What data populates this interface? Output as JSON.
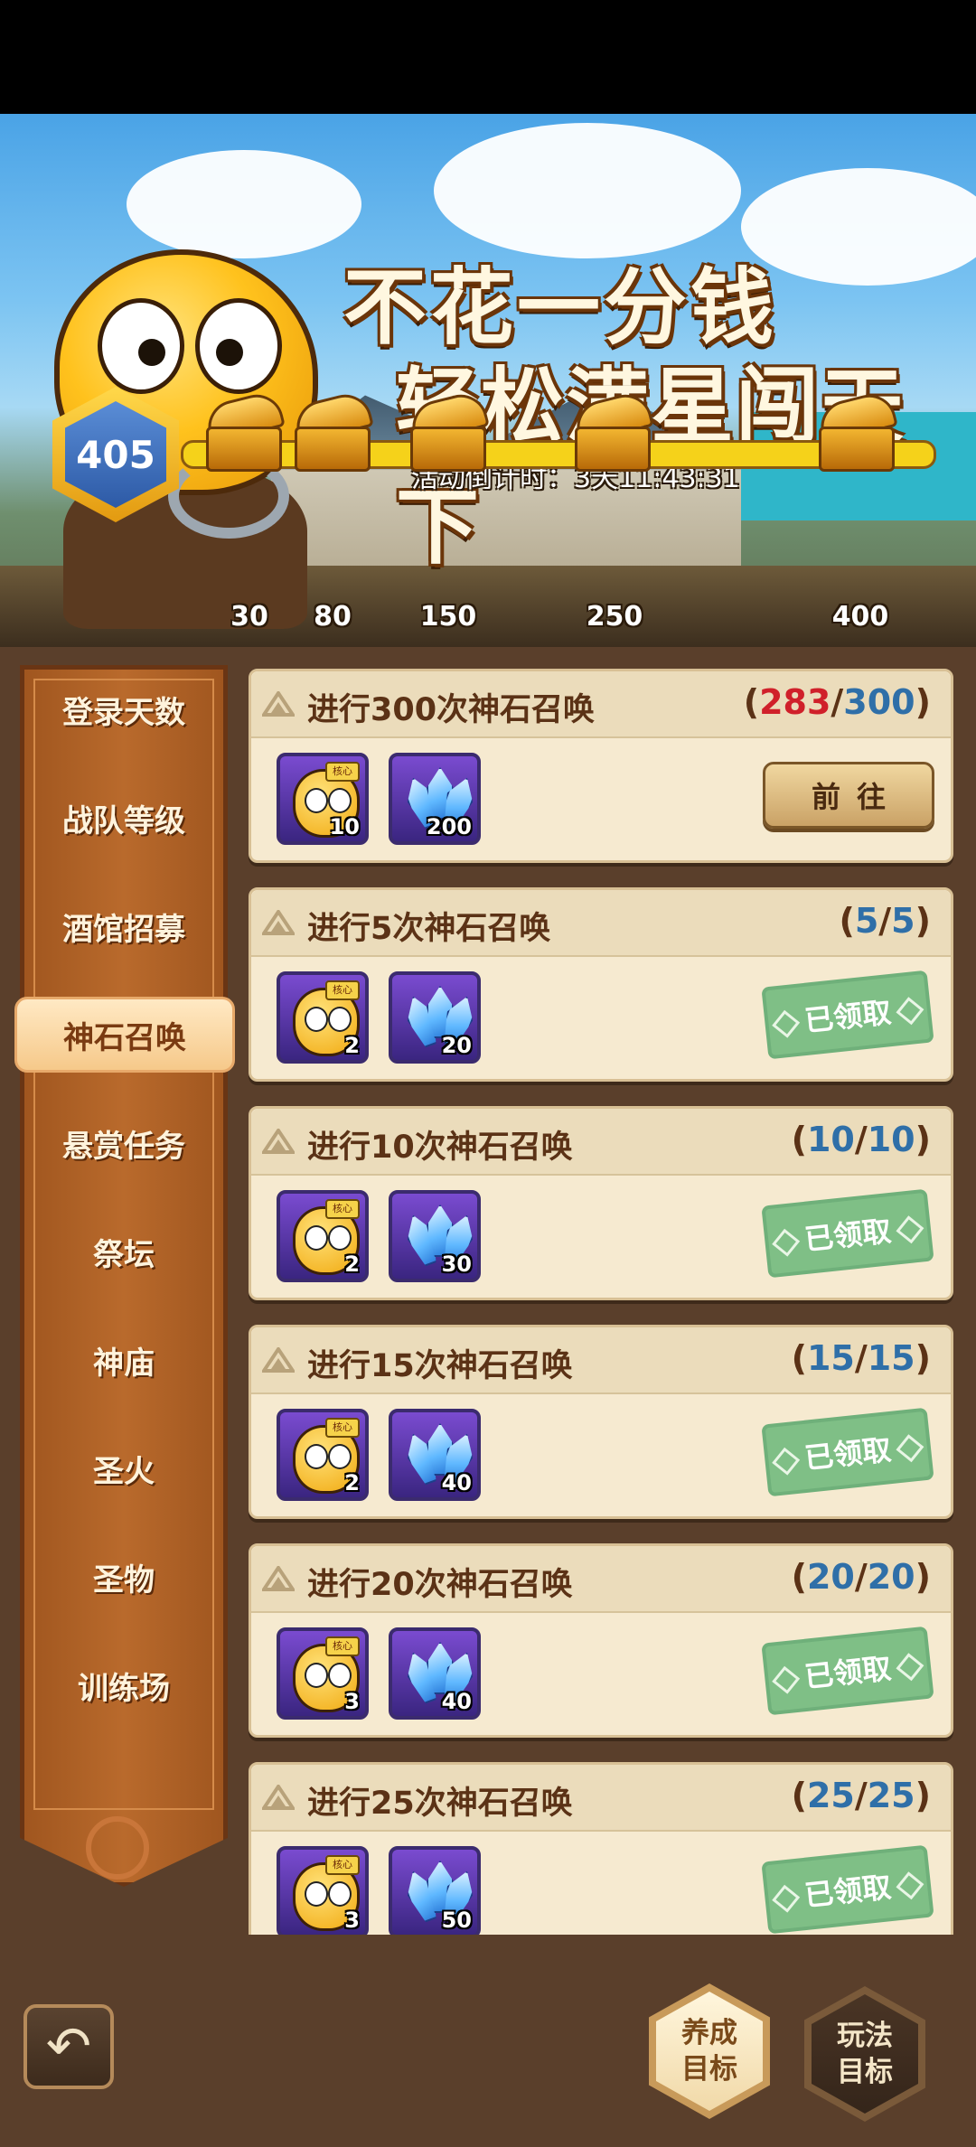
{
  "banner": {
    "title_line1": "不花一分钱",
    "title_line2": "轻松满星闯天下",
    "countdown": "活动倒计时：3天11:43:31",
    "score": "405",
    "chest_milestones": [
      "30",
      "80",
      "150",
      "250",
      "400"
    ]
  },
  "sidebar": {
    "items": [
      {
        "label": "登录天数",
        "active": false
      },
      {
        "label": "战队等级",
        "active": false
      },
      {
        "label": "酒馆招募",
        "active": false
      },
      {
        "label": "神石召唤",
        "active": true
      },
      {
        "label": "悬赏任务",
        "active": false
      },
      {
        "label": "祭坛",
        "active": false
      },
      {
        "label": "神庙",
        "active": false
      },
      {
        "label": "圣火",
        "active": false
      },
      {
        "label": "圣物",
        "active": false
      },
      {
        "label": "训练场",
        "active": false
      }
    ]
  },
  "tasks": [
    {
      "title": "进行300次神石召唤",
      "current": "283",
      "max": "300",
      "hero_count": "10",
      "crystal_count": "200",
      "status": "前往",
      "claimed": false
    },
    {
      "title": "进行5次神石召唤",
      "current": "5",
      "max": "5",
      "hero_count": "2",
      "crystal_count": "20",
      "status": "已领取",
      "claimed": true
    },
    {
      "title": "进行10次神石召唤",
      "current": "10",
      "max": "10",
      "hero_count": "2",
      "crystal_count": "30",
      "status": "已领取",
      "claimed": true
    },
    {
      "title": "进行15次神石召唤",
      "current": "15",
      "max": "15",
      "hero_count": "2",
      "crystal_count": "40",
      "status": "已领取",
      "claimed": true
    },
    {
      "title": "进行20次神石召唤",
      "current": "20",
      "max": "20",
      "hero_count": "3",
      "crystal_count": "40",
      "status": "已领取",
      "claimed": true
    },
    {
      "title": "进行25次神石召唤",
      "current": "25",
      "max": "25",
      "hero_count": "3",
      "crystal_count": "50",
      "status": "已领取",
      "claimed": true
    }
  ],
  "reward_tag": "核心",
  "bottom": {
    "back_icon": "back-arrow-icon",
    "nurture_label": "养成目标",
    "play_label": "玩法目标"
  }
}
